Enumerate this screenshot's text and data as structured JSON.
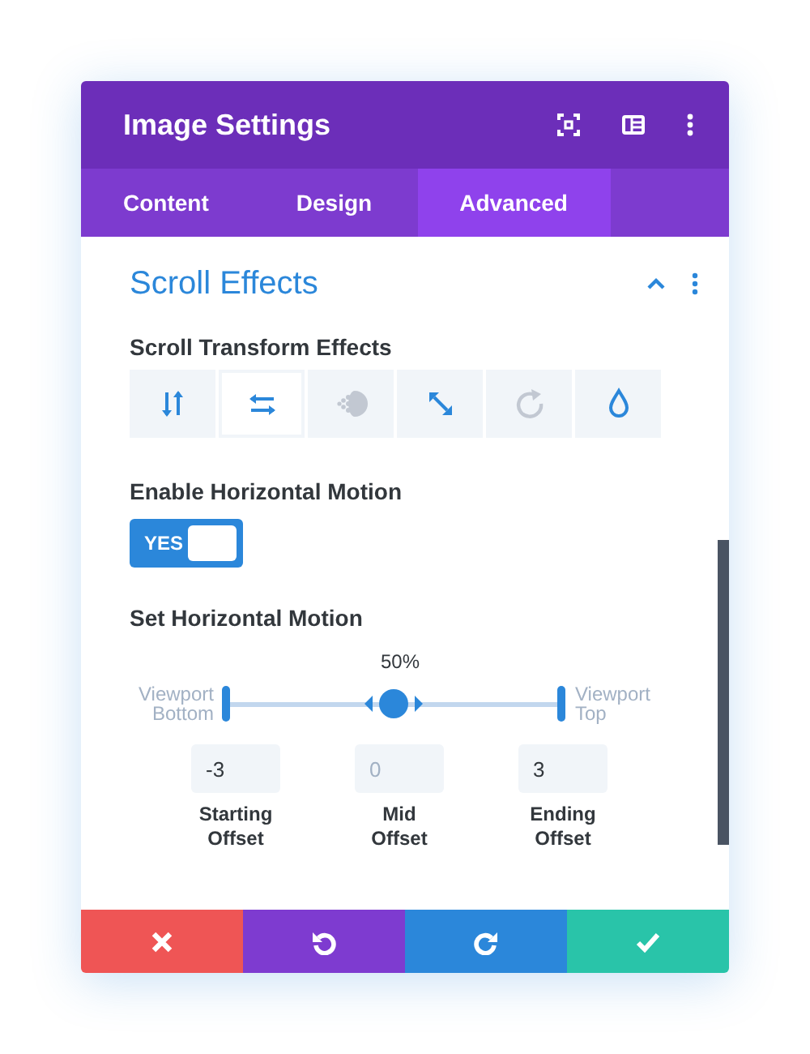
{
  "window": {
    "title": "Image Settings"
  },
  "tabs": [
    {
      "label": "Content",
      "selected": false
    },
    {
      "label": "Design",
      "selected": false
    },
    {
      "label": "Advanced",
      "selected": true
    }
  ],
  "section": {
    "title": "Scroll Effects",
    "expanded": true
  },
  "effects": {
    "label": "Scroll Transform Effects",
    "items": [
      {
        "kind": "vertical",
        "selected": false,
        "disabled": false
      },
      {
        "kind": "horizontal",
        "selected": true,
        "disabled": false
      },
      {
        "kind": "fade",
        "selected": false,
        "disabled": true
      },
      {
        "kind": "scale",
        "selected": false,
        "disabled": false
      },
      {
        "kind": "rotate",
        "selected": false,
        "disabled": true
      },
      {
        "kind": "blur",
        "selected": false,
        "disabled": false
      }
    ]
  },
  "toggle": {
    "label": "Enable Horizontal Motion",
    "on": true,
    "text": "YES"
  },
  "motion": {
    "label": "Set Horizontal Motion",
    "reading": "50%",
    "level": 0.5,
    "start_label": "Viewport Bottom",
    "end_label": "Viewport Top",
    "offsets": [
      {
        "value": "-3",
        "label": "Starting Offset"
      },
      {
        "placeholder": "0",
        "label": "Mid Offset"
      },
      {
        "value": "3",
        "label": "Ending Offset"
      }
    ]
  },
  "footer": [
    {
      "kind": "cancel"
    },
    {
      "kind": "undo"
    },
    {
      "kind": "redo"
    },
    {
      "kind": "save"
    }
  ]
}
